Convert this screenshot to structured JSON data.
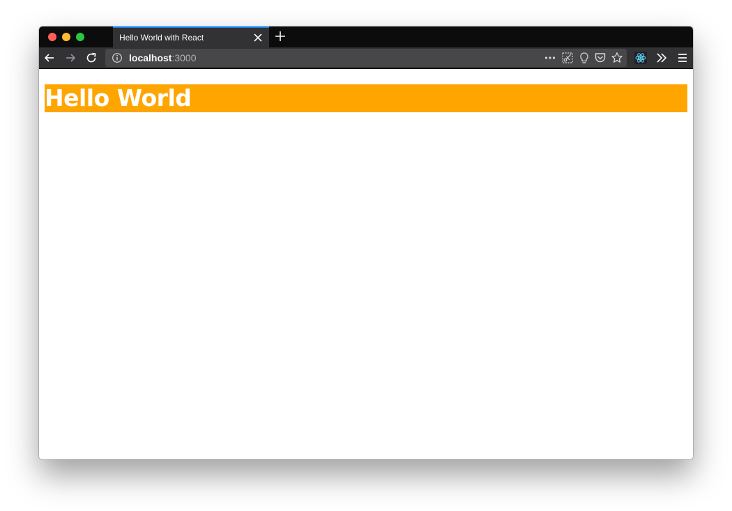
{
  "browser": {
    "tab": {
      "title": "Hello World with React"
    },
    "url": {
      "host": "localhost",
      "port": ":3000"
    }
  },
  "page": {
    "heading": "Hello World",
    "heading_bg": "#ffa500",
    "heading_color": "#ffffff"
  },
  "icons": {
    "back": "back-arrow-icon",
    "forward": "forward-arrow-icon",
    "reload": "reload-icon",
    "info": "info-icon",
    "more": "more-dots-icon",
    "screenshot": "screenshot-icon",
    "lightbulb": "lightbulb-icon",
    "pocket": "pocket-icon",
    "bookmark": "bookmark-star-icon",
    "react": "react-devtools-icon",
    "overflow": "overflow-chevron-icon",
    "menu": "hamburger-menu-icon"
  }
}
